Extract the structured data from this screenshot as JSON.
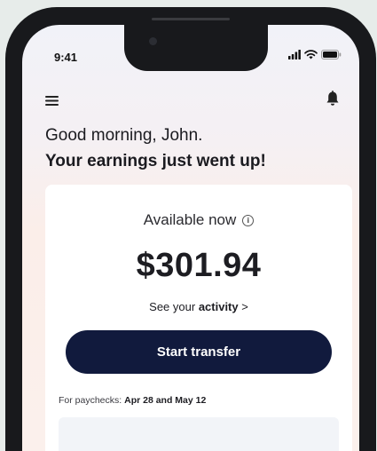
{
  "status_bar": {
    "time": "9:41"
  },
  "header": {
    "greeting": "Good morning, John.",
    "headline": "Your earnings just went up!"
  },
  "balance_card": {
    "available_label": "Available now",
    "amount": "$301.94",
    "activity_prefix": "See your ",
    "activity_link": "activity",
    "activity_chevron": ">",
    "transfer_label": "Start transfer",
    "paychecks_prefix": "For paychecks: ",
    "paychecks_dates": "Apr 28 and May 12"
  },
  "colors": {
    "primary_button": "#111a3d",
    "card_background": "#ffffff",
    "page_background": "#e7ecea"
  }
}
